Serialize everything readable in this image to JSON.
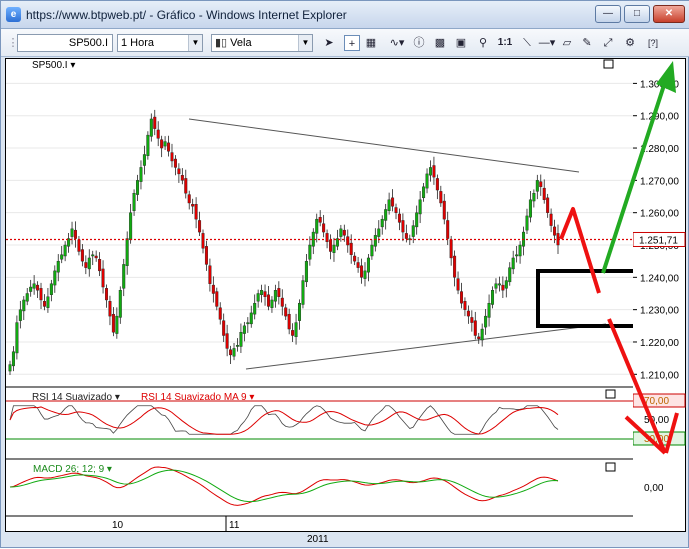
{
  "window": {
    "title": "https://www.btpweb.pt/ - Gráfico - Windows Internet Explorer"
  },
  "toolbar": {
    "symbol": "SP500.I",
    "interval": "1 Hora",
    "chart_style": "Vela",
    "zoom_label": "1:1"
  },
  "price_panel": {
    "symbol_label": "SP500.I ▾",
    "last_price": "1.251,71",
    "price_ticks": [
      "1.300,00",
      "1.290,00",
      "1.280,00",
      "1.270,00",
      "1.260,00",
      "1.250,00",
      "1.240,00",
      "1.230,00",
      "1.220,00",
      "1.210,00"
    ]
  },
  "rsi_panel": {
    "label": "RSI 14 Suavizado ▾",
    "ma_label": "RSI 14 Suavizado MA 9 ▾",
    "levels": [
      "70,00",
      "50,00",
      "30,00"
    ]
  },
  "macd_panel": {
    "label": "MACD 26; 12; 9 ▾",
    "ticks": [
      "0,00"
    ]
  },
  "x_axis": {
    "day_labels": [
      "10",
      "11"
    ],
    "year_label": "2011"
  },
  "colors": {
    "bull": "#11aa11",
    "bear": "#dd0000",
    "rsi_line": "#444444",
    "rsi_ma": "#dd0000",
    "overbought": "#cc0000",
    "oversold": "#008800",
    "macd": "#dd0000",
    "signal": "#11aa11",
    "annot_green": "#22aa22",
    "annot_red": "#ee1111"
  },
  "chart_data": {
    "type": "candlestick",
    "ylim": [
      1207,
      1306
    ],
    "closes": [
      1213,
      1217,
      1226,
      1230,
      1233,
      1235,
      1237,
      1238,
      1236,
      1233,
      1231,
      1234,
      1238,
      1242,
      1245,
      1247,
      1250,
      1252,
      1255,
      1252,
      1248,
      1245,
      1243,
      1246,
      1247,
      1246,
      1242,
      1237,
      1233,
      1228,
      1223,
      1228,
      1236,
      1244,
      1252,
      1260,
      1266,
      1270,
      1274,
      1278,
      1284,
      1289,
      1286,
      1283,
      1280,
      1282,
      1279,
      1276,
      1274,
      1272,
      1270,
      1266,
      1263,
      1262,
      1258,
      1254,
      1249,
      1244,
      1238,
      1235,
      1231,
      1227,
      1222,
      1218,
      1216,
      1218,
      1219,
      1223,
      1225,
      1226,
      1229,
      1232,
      1235,
      1236,
      1234,
      1231,
      1233,
      1236,
      1234,
      1231,
      1228,
      1224,
      1222,
      1226,
      1232,
      1239,
      1245,
      1250,
      1254,
      1258,
      1257,
      1254,
      1251,
      1248,
      1250,
      1252,
      1255,
      1253,
      1250,
      1247,
      1245,
      1243,
      1240,
      1242,
      1246,
      1250,
      1253,
      1255,
      1258,
      1261,
      1264,
      1262,
      1260,
      1257,
      1254,
      1252,
      1252,
      1256,
      1260,
      1264,
      1268,
      1272,
      1274,
      1271,
      1267,
      1263,
      1258,
      1252,
      1246,
      1240,
      1236,
      1232,
      1230,
      1228,
      1226,
      1222,
      1221,
      1224,
      1228,
      1232,
      1236,
      1238,
      1238,
      1236,
      1239,
      1243,
      1246,
      1247,
      1250,
      1254,
      1259,
      1264,
      1266,
      1270,
      1268,
      1264,
      1260,
      1256,
      1253,
      1250
    ]
  }
}
